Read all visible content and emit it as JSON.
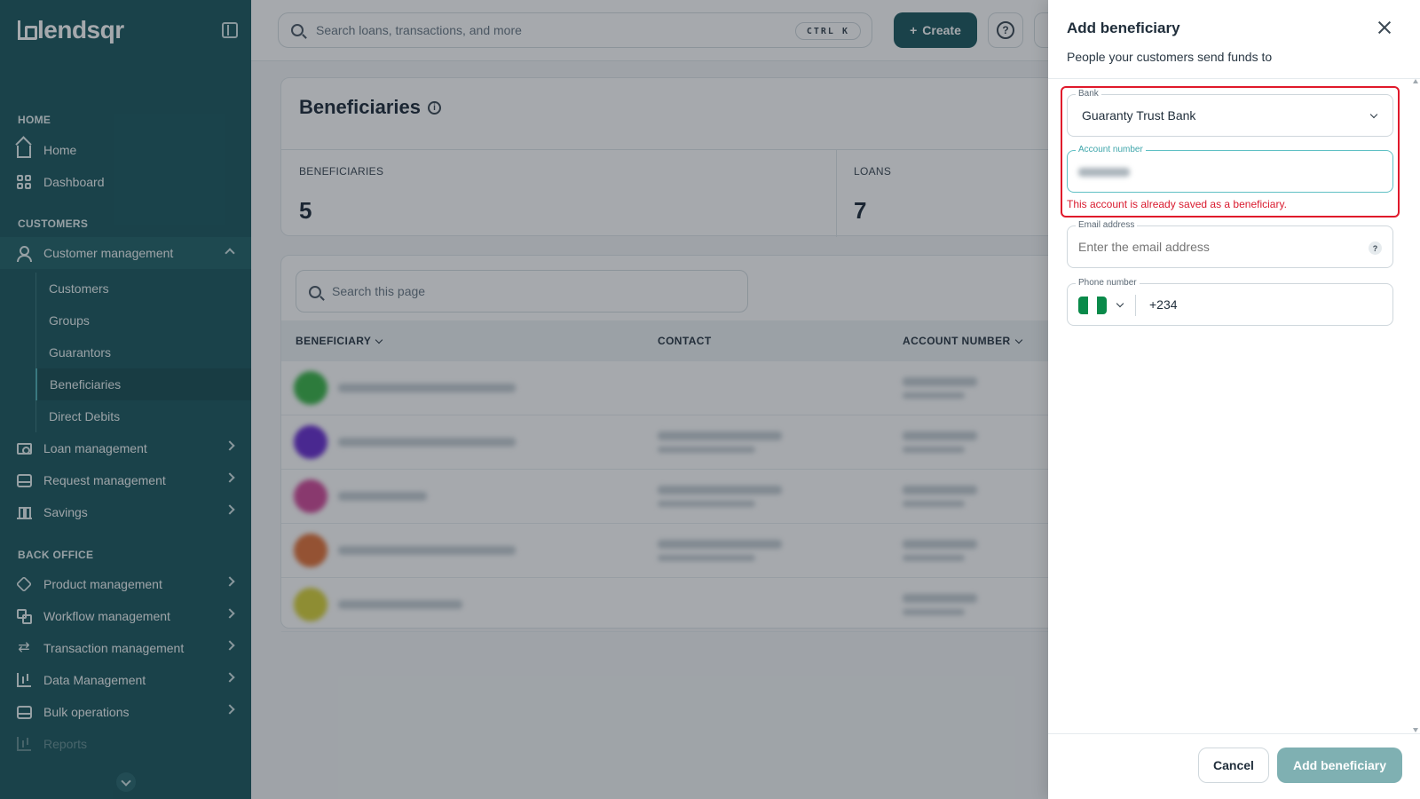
{
  "brand": {
    "name": "lendsqr"
  },
  "sidebar": {
    "sections": {
      "home": "HOME",
      "customers": "CUSTOMERS",
      "back_office": "BACK OFFICE"
    },
    "items": {
      "home": "Home",
      "dashboard": "Dashboard",
      "customer_management": "Customer management",
      "loan_management": "Loan management",
      "request_management": "Request management",
      "savings": "Savings",
      "product_management": "Product management",
      "workflow_management": "Workflow management",
      "transaction_management": "Transaction management",
      "data_management": "Data Management",
      "bulk_operations": "Bulk operations",
      "reports": "Reports"
    },
    "sub_items": {
      "customers": "Customers",
      "groups": "Groups",
      "guarantors": "Guarantors",
      "beneficiaries": "Beneficiaries",
      "direct_debits": "Direct Debits"
    }
  },
  "topbar": {
    "search_placeholder": "Search loans, transactions, and more",
    "shortcut": "CTRL K",
    "create_label": "Create",
    "help_glyph": "?"
  },
  "main": {
    "title": "Beneficiaries",
    "stats": [
      {
        "label": "BENEFICIARIES",
        "value": "5"
      },
      {
        "label": "LOANS",
        "value": "7"
      }
    ],
    "page_search_placeholder": "Search this page",
    "columns": {
      "beneficiary": "BENEFICIARY",
      "contact": "CONTACT",
      "account_number": "ACCOUNT NUMBER"
    },
    "rows": [
      {
        "avatar_color": "#3db54a",
        "has_contact": false
      },
      {
        "avatar_color": "#6a2fd1",
        "has_contact": true
      },
      {
        "avatar_color": "#d14b9a",
        "has_contact": true
      },
      {
        "avatar_color": "#e2733a",
        "has_contact": true
      },
      {
        "avatar_color": "#d9d23a",
        "has_contact": false
      }
    ]
  },
  "panel": {
    "title": "Add beneficiary",
    "subtitle": "People your customers send funds to",
    "bank": {
      "label": "Bank",
      "value": "Guaranty Trust Bank"
    },
    "account": {
      "label": "Account number"
    },
    "error": "This account is already saved as a beneficiary.",
    "email": {
      "label": "Email address",
      "placeholder": "Enter the email address"
    },
    "phone": {
      "label": "Phone number",
      "code": "+234"
    },
    "cancel_label": "Cancel",
    "submit_label": "Add beneficiary"
  },
  "colors": {
    "sidebar": "#1e5a60",
    "accent": "#1e5a60",
    "focus": "#5fc0c4",
    "error": "#e0192b",
    "submit_disabled": "#7fb0b2"
  }
}
